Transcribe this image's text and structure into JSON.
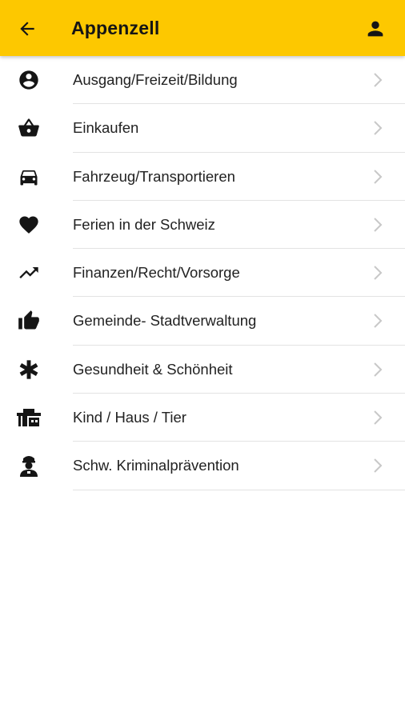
{
  "appbar": {
    "title": "Appenzell",
    "back_icon": "arrow-back-icon",
    "profile_icon": "person-icon",
    "background_color": "#fdc800"
  },
  "categories": [
    {
      "label": "Ausgang/Freizeit/Bildung",
      "icon": "account-circle-icon"
    },
    {
      "label": "Einkaufen",
      "icon": "shopping-basket-icon"
    },
    {
      "label": "Fahrzeug/Transportieren",
      "icon": "car-icon"
    },
    {
      "label": "Ferien in der Schweiz",
      "icon": "heart-icon"
    },
    {
      "label": "Finanzen/Recht/Vorsorge",
      "icon": "trending-up-icon"
    },
    {
      "label": "Gemeinde- Stadtverwaltung",
      "icon": "thumb-up-icon"
    },
    {
      "label": "Gesundheit & Schönheit",
      "icon": "asterisk-icon"
    },
    {
      "label": "Kind / Haus / Tier",
      "icon": "house-icon"
    },
    {
      "label": "Schw. Kriminalprävention",
      "icon": "police-officer-icon"
    }
  ]
}
